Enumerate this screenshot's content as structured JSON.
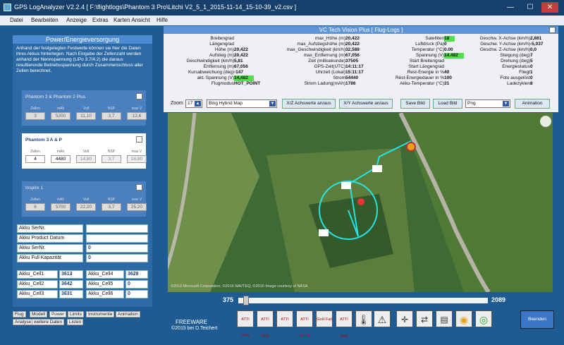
{
  "window": {
    "title": "GPS LogAnalyzer V2.2.4    [ F:\\flightlogs\\Phantom 3 Pro\\Litchi V2_5_1_2015-11-14_15-10-39_v2.csv ]",
    "min": "—",
    "max": "☐",
    "close": "✕"
  },
  "menu": [
    "Datei",
    "Bearbeiten",
    "Anzeige",
    "Extras",
    "Karten Ansicht",
    "Hilfe"
  ],
  "left": {
    "header": "Power/Energieversorgung",
    "desc": "Anhand der festgelegten Festwerte können sie hier die Daten ihres Akkus hinterlegen. Nach Eingabe der Zellenzahl werden anhand der Nennspannung (LiPo 3.7/4.2) die daraus resultierende Betriebsspannung durch Zusammenschluss aller Zellen berechnet.",
    "cards": [
      {
        "name": "Phantom 2 & Phantom 2 Plus",
        "labels": [
          "Zellen",
          "mAh",
          "Volt",
          "NSP",
          "max V"
        ],
        "values": [
          "3",
          "5200",
          "11,10",
          "3,7",
          "12,6"
        ]
      },
      {
        "name": "Phantom 3 A & P",
        "labels": [
          "Zellen",
          "mAh",
          "Volt",
          "NSP",
          "max V"
        ],
        "values": [
          "4",
          "4480",
          "14,80",
          "3,7",
          "16,80"
        ]
      },
      {
        "name": "Inspire 1",
        "labels": [
          "Zellen",
          "mAh",
          "Volt",
          "NSP",
          "max V"
        ],
        "values": [
          "6",
          "5700",
          "22,20",
          "3,7",
          "25,20"
        ]
      }
    ],
    "akku_rows": [
      {
        "label": "Akku SerNr.",
        "value": ""
      },
      {
        "label": "Akku Product Datum",
        "value": ""
      },
      {
        "label": "Akku SerNr.",
        "value": "0"
      },
      {
        "label": "Akku Full Kapazität",
        "value": "0"
      }
    ],
    "cells": [
      {
        "l1": "Akku_Cell1",
        "v1": "3613",
        "l2": "Akku_Cell4",
        "v2": "3628"
      },
      {
        "l1": "Akku_Cell2",
        "v1": "3642",
        "l2": "Akku_Cell5",
        "v2": "0"
      },
      {
        "l1": "Akku_Cell3",
        "v1": "3631",
        "l2": "Akku_Cell6",
        "v2": "0"
      }
    ],
    "tabs_row1": [
      "Flug",
      "Modell",
      "Power",
      "Limits",
      "Instrumente",
      "Animation"
    ],
    "tabs_row2": [
      "Analyse",
      "weitere Daten",
      "Listen"
    ]
  },
  "right": {
    "header": "VC Tech Vision Plus [ Flug-Logs ]",
    "col1": [
      {
        "l": "Breitengrad",
        "v": ""
      },
      {
        "l": "Längengrad",
        "v": ""
      },
      {
        "l": "Höhe (m)",
        "v": "20,422"
      },
      {
        "l": "Aufstieg (m)",
        "v": "20,422"
      },
      {
        "l": "Geschwindigkeit (km/h)",
        "v": "5,81"
      },
      {
        "l": "Entfernung (m)",
        "v": "67,056"
      },
      {
        "l": "Kursabweichung (deg)",
        "v": "-147"
      },
      {
        "l": "akt. Spannung (V)",
        "v": "14,482",
        "g": true
      },
      {
        "l": "Flugmodus",
        "v": "HOT_POINT"
      }
    ],
    "col2": [
      {
        "l": "max_Höhe (m)",
        "v": "20,422"
      },
      {
        "l": "max_Aufstiegshöhe (m)",
        "v": "20,422"
      },
      {
        "l": "max_Geschwindigkeit (km/h)",
        "v": "32,588"
      },
      {
        "l": "max_Entfernung (m)",
        "v": "67,056"
      },
      {
        "l": "Zeit (millisekunde)",
        "v": "37505"
      },
      {
        "l": "GPS-Zeit(UTC)",
        "v": "14:11:17"
      },
      {
        "l": "Uhrzeit (Lokal)",
        "v": "15:11:17"
      },
      {
        "l": "Strom",
        "v": "54440"
      },
      {
        "l": "Strom Ladung(mAh)",
        "v": "1786"
      }
    ],
    "col3": [
      {
        "l": "Satelliten",
        "v": "18",
        "g": true
      },
      {
        "l": "Luftdruck (Pa)",
        "v": "0"
      },
      {
        "l": "Temperatur (°C)",
        "v": "0.00"
      },
      {
        "l": "Spannung (V)",
        "v": "14.482",
        "g": true
      },
      {
        "l": "Start Breitengrad",
        "v": ""
      },
      {
        "l": "Start Längengrad",
        "v": ""
      },
      {
        "l": "Rest-Energie in %",
        "v": "40"
      },
      {
        "l": "Rest-Energiedauer in %",
        "v": "100"
      },
      {
        "l": "Akku-Temperatur (°C)",
        "v": "31"
      }
    ],
    "col4": [
      {
        "l": "Geschw. X-Achse (km/h)",
        "v": "2,881"
      },
      {
        "l": "Geschw. Y-Achse (km/h)",
        "v": "-5,037"
      },
      {
        "l": "Geschw. Z-Achse (km/h)",
        "v": "0,0"
      },
      {
        "l": "Steigung (deg)",
        "v": "7"
      },
      {
        "l": "Drehung (deg)",
        "v": "5"
      },
      {
        "l": "Energiestatus",
        "v": "0"
      },
      {
        "l": "Fliegt",
        "v": "1"
      },
      {
        "l": "Foto ausgelöst",
        "v": "0"
      },
      {
        "l": "Ladezyklen",
        "v": "8"
      }
    ],
    "controls": {
      "zoom_label": "Zoom",
      "zoom_value": "17",
      "map_type": "Bing Hybrid Map",
      "xz": "X/Z Achswerte an/aus",
      "xy": "X/Y Achswerte an/aus",
      "save": "Save Bild",
      "load": "Load Bild",
      "format": "Png",
      "animation": "Animation"
    }
  },
  "map": {
    "copyright": "©2016 Microsoft Corporation, ©2016 NAVTEQ, ©2016 Image courtesy of NASA"
  },
  "timeline": {
    "start": "375",
    "end": "2089",
    "position": 0.02
  },
  "footer": {
    "freeware": "FREEWARE",
    "credit": "©2015  bei D.Teichert",
    "beenden": "Beenden"
  },
  "icons": [
    "ATTI ????",
    "ATTI GPS",
    "ATTI",
    "ATTI FOTO",
    "GoH Fail",
    "ATTI GoH"
  ],
  "colors": {
    "accent": "#2e58a8",
    "highlight": "#4fe04f",
    "track": "#27e3e3"
  }
}
